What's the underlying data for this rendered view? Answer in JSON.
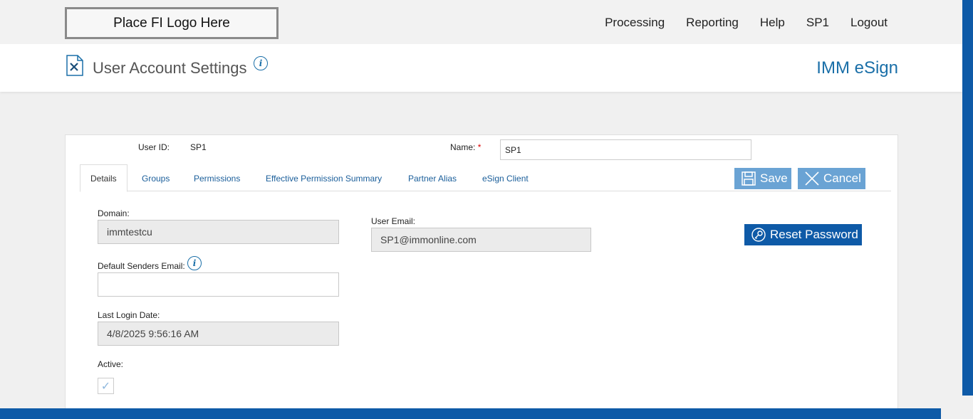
{
  "header": {
    "logo_text": "Place FI Logo Here",
    "nav": [
      "Processing",
      "Reporting",
      "Help",
      "SP1",
      "Logout"
    ]
  },
  "titlebar": {
    "title": "User Account Settings",
    "brand": "IMM eSign"
  },
  "form": {
    "user_id_label": "User ID:",
    "user_id_value": "SP1",
    "name_label": "Name:",
    "name_required": "*",
    "name_value": "SP1",
    "tabs": [
      "Details",
      "Groups",
      "Permissions",
      "Effective Permission Summary",
      "Partner Alias",
      "eSign Client"
    ],
    "active_tab": "Details",
    "save_label": "Save",
    "cancel_label": "Cancel",
    "reset_password_label": "Reset Password",
    "domain_label": "Domain:",
    "domain_value": "immtestcu",
    "default_senders_email_label": "Default Senders Email:",
    "default_senders_email_value": "",
    "last_login_label": "Last Login Date:",
    "last_login_value": "4/8/2025 9:56:16 AM",
    "active_label": "Active:",
    "active_checked": true,
    "user_email_label": "User Email:",
    "user_email_value": "SP1@immonline.com"
  },
  "colors": {
    "accent": "#0e5aa7",
    "button_light": "#6aa3d4",
    "link": "#1a5e9a"
  }
}
